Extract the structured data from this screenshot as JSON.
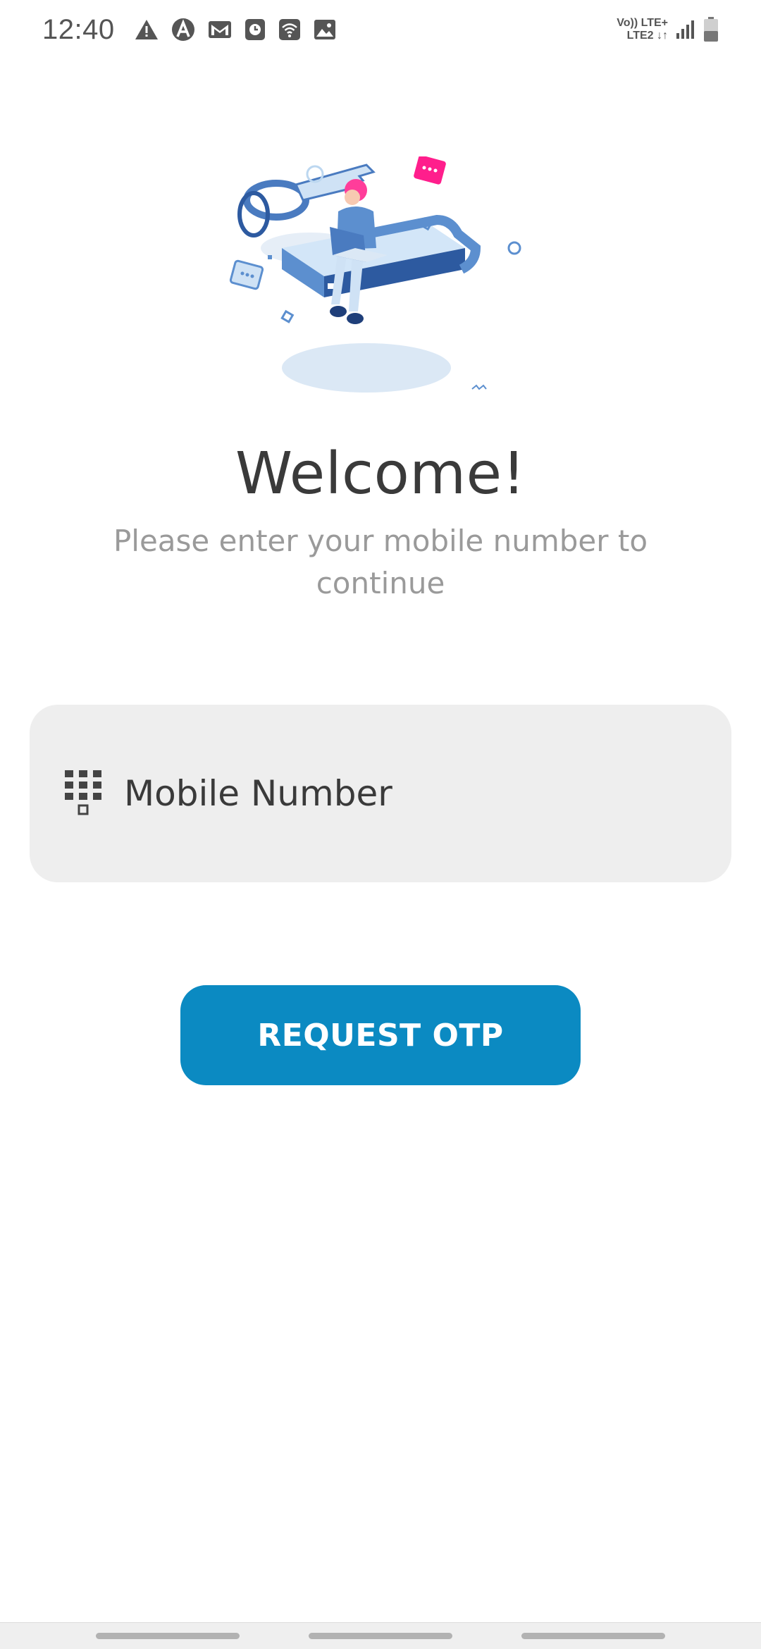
{
  "status_bar": {
    "time": "12:40",
    "notification_icons": [
      "warning-icon",
      "a-circle-icon",
      "gmail-icon",
      "clock-icon",
      "wifi-icon",
      "image-icon"
    ],
    "network_line1": "Vo)) LTE+",
    "network_line2": "LTE2 ↓↑"
  },
  "login": {
    "title": "Welcome!",
    "subtitle": "Please enter your mobile number to continue",
    "mobile_field": {
      "icon": "dialpad-icon",
      "placeholder": "Mobile Number",
      "value": ""
    },
    "request_button_label": "REQUEST OTP"
  },
  "colors": {
    "primary": "#0b8ac2",
    "field_background": "#eeeeee",
    "title_text": "#3a3a3a",
    "subtitle_text": "#9a9a9a"
  }
}
